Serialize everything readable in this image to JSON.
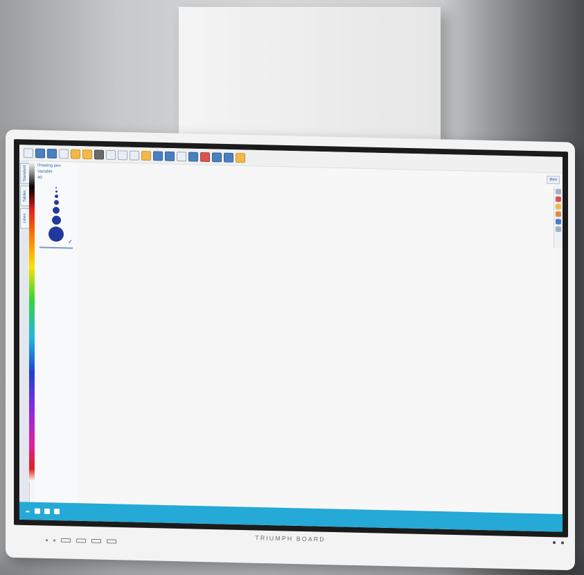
{
  "scene": {
    "description_colors": {
      "wall": "#cfd1d3",
      "bezel": "#1b1b1b",
      "frame": "#f3f3f3",
      "taskbar": "#25a9d6"
    }
  },
  "display": {
    "brand_logo": "TRIUMPH BOARD",
    "software": {
      "toolbar_icons": [
        "menu-icon",
        "undo-icon",
        "save-icon",
        "open-icon",
        "new-page-icon",
        "folder-icon",
        "print-icon",
        "text-icon",
        "search-icon",
        "zoom-icon",
        "image-icon",
        "shapes-icon",
        "line-icon",
        "table-icon",
        "web-icon",
        "record-icon",
        "camera-icon",
        "screen-icon",
        "settings-icon"
      ],
      "side_tabs": [
        "Standard",
        "Tables",
        "Lines"
      ],
      "palette": {
        "title": "Drawing pen",
        "mode_label": "Variable",
        "size_select": "40"
      },
      "user_chip": "Ben"
    }
  }
}
